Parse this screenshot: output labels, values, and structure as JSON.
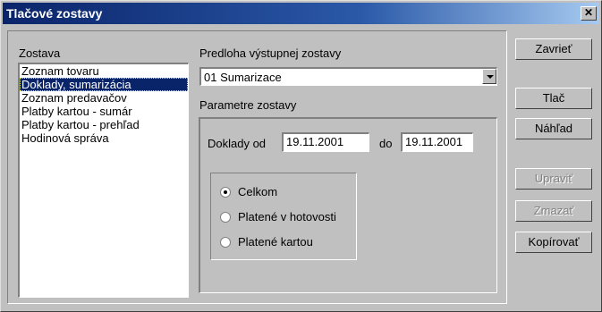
{
  "window": {
    "title": "Tlačové zostavy",
    "close_glyph": "✕"
  },
  "zostava": {
    "label": "Zostava",
    "items": [
      "Zoznam tovaru",
      "Doklady, sumarizácia",
      "Zoznam predavačov",
      "Platby kartou - sumár",
      "Platby kartou - prehľad",
      "Hodinová správa"
    ],
    "selected_index": 1
  },
  "predloha": {
    "label": "Predloha výstupnej zostavy",
    "value": "01 Sumarizace"
  },
  "parametre": {
    "label": "Parametre zostavy",
    "doklady_od_label": "Doklady od",
    "date_from": "19.11.2001",
    "do_label": "do",
    "date_to": "19.11.2001",
    "radios": [
      {
        "label": "Celkom",
        "checked": true
      },
      {
        "label": "Platené v hotovosti",
        "checked": false
      },
      {
        "label": "Platené kartou",
        "checked": false
      }
    ]
  },
  "buttons": {
    "zavriet": "Zavrieť",
    "tlac": "Tlač",
    "nahlad": "Náhľad",
    "upravit": "Upraviť",
    "zmazat": "Zmazať",
    "kopirovat": "Kopírovať"
  }
}
